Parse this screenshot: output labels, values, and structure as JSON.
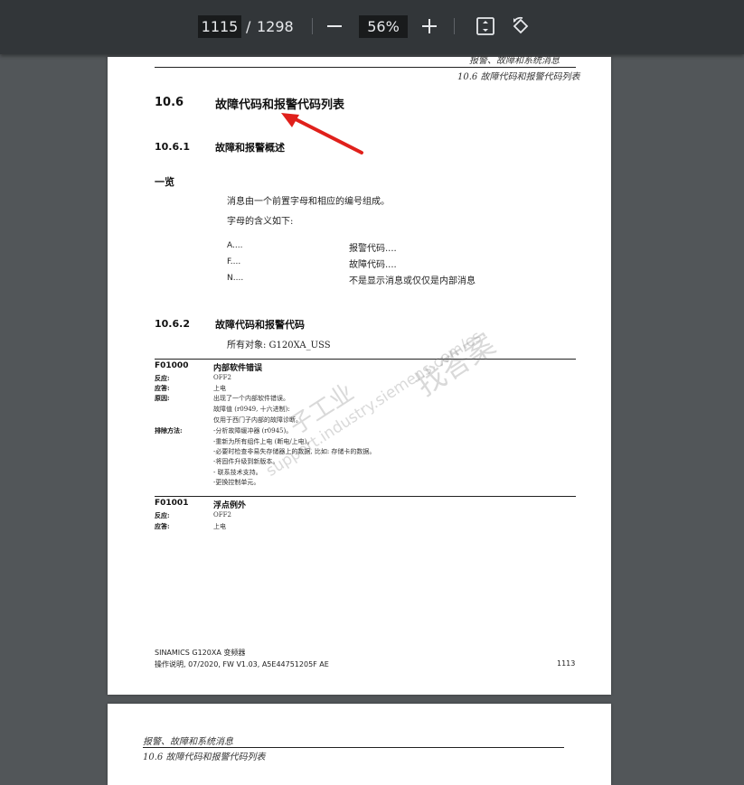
{
  "toolbar": {
    "current_page": "1115",
    "separator": "/",
    "total_pages": "1298",
    "zoom": "56%",
    "icons": [
      "minus-icon",
      "plus-icon",
      "fit-page-icon",
      "rotate-icon"
    ]
  },
  "page1": {
    "header_line1": "报警、故障和系统消息",
    "header_line2": "10.6 故障代码和报警代码列表",
    "section": {
      "num": "10.6",
      "title": "故障代码和报警代码列表"
    },
    "sub1": {
      "num": "10.6.1",
      "title": "故障和报警概述"
    },
    "overview_heading": "一览",
    "intro1": "消息由一个前置字母和相应的编号组成。",
    "intro2": "字母的含义如下:",
    "letters": [
      {
        "code": "A....",
        "desc": "报警代码...."
      },
      {
        "code": "F....",
        "desc": "故障代码...."
      },
      {
        "code": "N....",
        "desc": "不是显示消息或仅仅是内部消息"
      }
    ],
    "sub2": {
      "num": "10.6.2",
      "title": "故障代码和报警代码"
    },
    "all_objects": "所有对象: G120XA_USS",
    "fault1": {
      "code": "F01000",
      "title": "内部软件错误",
      "reaction_label": "反应:",
      "reaction": "OFF2",
      "ack_label": "应答:",
      "ack": "上电",
      "cause_label": "原因:",
      "cause_lines": [
        "出现了一个内部软件错误。",
        "故障值 (r0949, 十六进制):",
        "仅用于西门子内部的故障诊断。"
      ],
      "remedy_label": "排除方法:",
      "remedy_lines": [
        "-分析故障缓冲器 (r0945)。",
        "-重新为所有组件上电 (断电/上电)。",
        "-必要时检查非易失存储器上的数据, 比如: 存储卡的数据。",
        "-将固件升级到新版本。",
        "- 联系技术支持。",
        "-更换控制单元。"
      ]
    },
    "fault2": {
      "code": "F01001",
      "title": "浮点例外",
      "reaction_label": "反应:",
      "reaction": "OFF2",
      "ack_label": "应答:",
      "ack": "上电"
    },
    "footer_line1": "SINAMICS G120XA 变频器",
    "footer_line2": "操作说明, 07/2020, FW V1.03, A5E44751205F AE",
    "page_number": "1113",
    "watermark1": "找答案",
    "watermark2": "support.industry.siemens.com/cs",
    "watermark3": "子工业"
  },
  "page2": {
    "header_line1": "报警、故障和系统消息",
    "header_line2": "10.6 故障代码和报警代码列表"
  },
  "colors": {
    "toolbar": "#323639",
    "background": "#525659",
    "arrow": "#e0201b"
  }
}
